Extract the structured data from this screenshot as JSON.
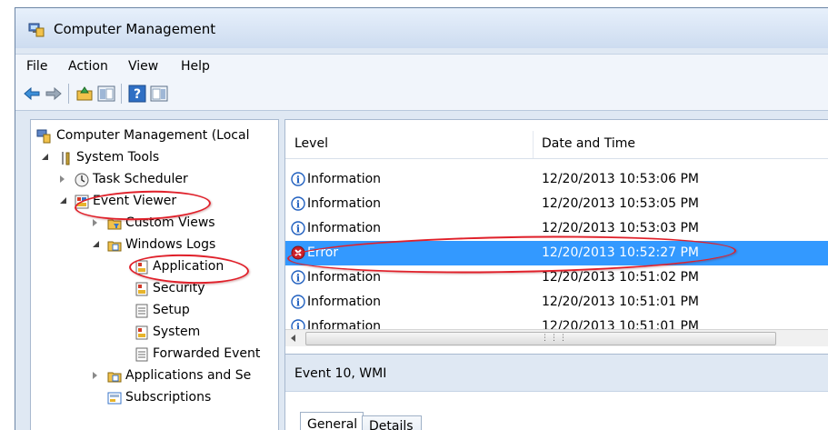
{
  "window": {
    "title": "Computer Management"
  },
  "menu": [
    "File",
    "Action",
    "View",
    "Help"
  ],
  "toolbar": [
    "back-arrow-icon",
    "forward-arrow-icon",
    "up-folder-icon",
    "show-hide-console-tree-icon",
    "help-icon",
    "show-hide-action-pane-icon"
  ],
  "tree": {
    "root": "Computer Management (Local",
    "system_tools": "System Tools",
    "task_scheduler": "Task Scheduler",
    "event_viewer": "Event Viewer",
    "custom_views": "Custom Views",
    "windows_logs": "Windows Logs",
    "application": "Application",
    "security": "Security",
    "setup": "Setup",
    "system": "System",
    "forwarded_events": "Forwarded Event",
    "apps_services": "Applications and Se",
    "subscriptions": "Subscriptions"
  },
  "list": {
    "columns": [
      "Level",
      "Date and Time"
    ],
    "rows": [
      {
        "level": "Information",
        "datetime": "12/20/2013 10:53:06 PM",
        "selected": false
      },
      {
        "level": "Information",
        "datetime": "12/20/2013 10:53:05 PM",
        "selected": false
      },
      {
        "level": "Information",
        "datetime": "12/20/2013 10:53:03 PM",
        "selected": false
      },
      {
        "level": "Error",
        "datetime": "12/20/2013 10:52:27 PM",
        "selected": true
      },
      {
        "level": "Information",
        "datetime": "12/20/2013 10:51:02 PM",
        "selected": false
      },
      {
        "level": "Information",
        "datetime": "12/20/2013 10:51:01 PM",
        "selected": false
      },
      {
        "level": "Information",
        "datetime": "12/20/2013 10:51:01 PM",
        "selected": false
      }
    ]
  },
  "detail": {
    "title": "Event 10, WMI",
    "tabs": [
      "General",
      "Details"
    ]
  },
  "colors": {
    "selection": "#3399ff",
    "highlight_circle": "#e0202a",
    "info_icon": "#1f5fbf",
    "error_icon": "#c8202a"
  }
}
